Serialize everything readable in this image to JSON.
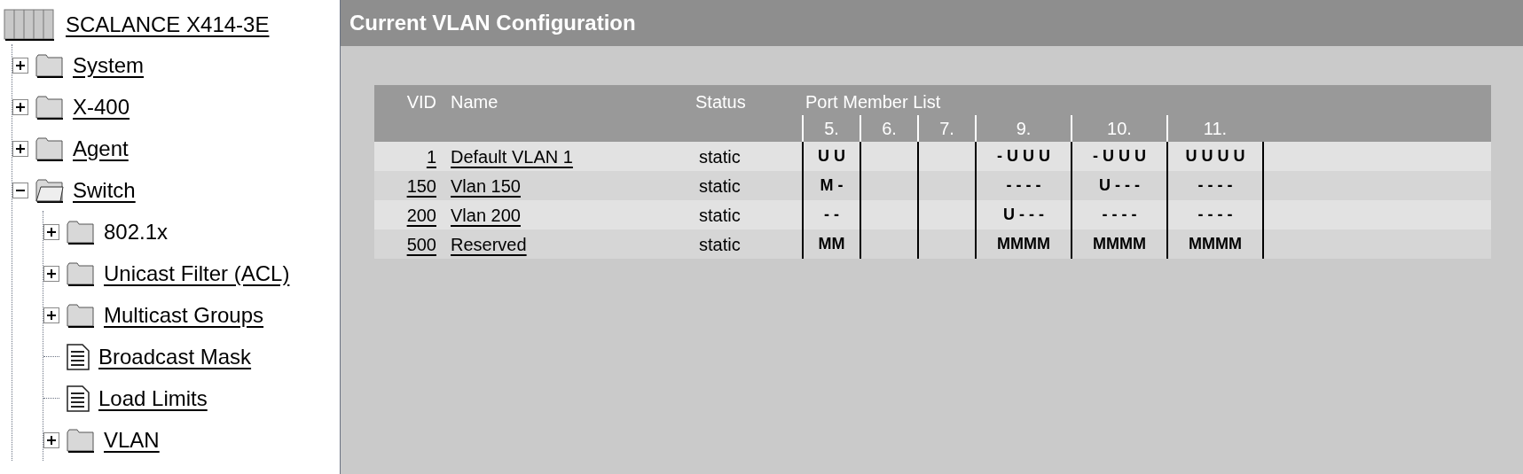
{
  "tree": {
    "label": "SCALANCE X414-3E",
    "items": [
      {
        "label": "System",
        "kind": "folder",
        "expanded": false,
        "link": true
      },
      {
        "label": "X-400",
        "kind": "folder",
        "expanded": false,
        "link": true
      },
      {
        "label": "Agent",
        "kind": "folder",
        "expanded": false,
        "link": true
      },
      {
        "label": "Switch",
        "kind": "folder",
        "expanded": true,
        "link": true,
        "children": [
          {
            "label": "802.1x",
            "kind": "folder",
            "expanded": false,
            "link": false
          },
          {
            "label": "Unicast Filter (ACL)",
            "kind": "folder",
            "expanded": false,
            "link": true
          },
          {
            "label": "Multicast Groups",
            "kind": "folder",
            "expanded": false,
            "link": true
          },
          {
            "label": "Broadcast Mask",
            "kind": "page",
            "link": true
          },
          {
            "label": "Load Limits",
            "kind": "page",
            "link": true
          },
          {
            "label": "VLAN",
            "kind": "folder",
            "expanded": false,
            "link": true
          }
        ]
      }
    ]
  },
  "page": {
    "title": "Current VLAN Configuration",
    "table": {
      "columns": [
        "VID",
        "Name",
        "Status",
        "Port Member List"
      ],
      "ports": [
        {
          "label": "5.",
          "wide": false
        },
        {
          "label": "6.",
          "wide": false
        },
        {
          "label": "7.",
          "wide": false
        },
        {
          "label": "9.",
          "wide": true
        },
        {
          "label": "10.",
          "wide": true
        },
        {
          "label": "11.",
          "wide": true
        }
      ],
      "rows": [
        {
          "vid": "1",
          "name": "Default VLAN 1",
          "status": "static",
          "ports": {
            "0": "U U",
            "3": "- U U U",
            "4": "- U U U",
            "5": "U U U U"
          }
        },
        {
          "vid": "150",
          "name": "Vlan 150",
          "status": "static",
          "ports": {
            "0": "M -",
            "3": "- - - -",
            "4": "U - - -",
            "5": "- - - -"
          }
        },
        {
          "vid": "200",
          "name": "Vlan 200",
          "status": "static",
          "ports": {
            "0": "- -",
            "3": "U - - -",
            "4": "- - - -",
            "5": "- - - -"
          }
        },
        {
          "vid": "500",
          "name": "Reserved",
          "status": "static",
          "ports": {
            "0": "MM",
            "3": "MMMM",
            "4": "MMMM",
            "5": "MMMM"
          }
        }
      ]
    }
  }
}
